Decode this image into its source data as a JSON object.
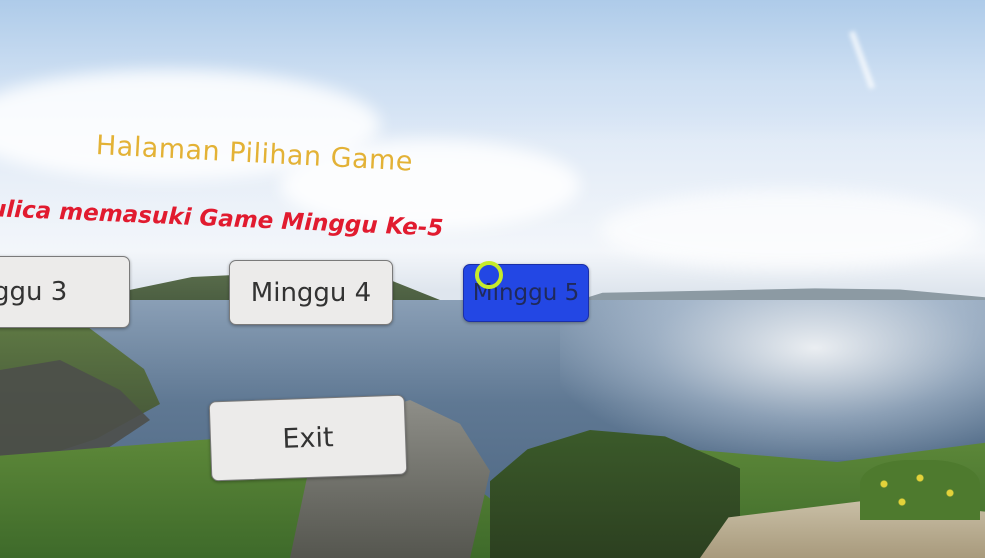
{
  "screen": {
    "title": "Halaman Pilihan Game",
    "subtitle": "ulica memasuki Game Minggu Ke-5"
  },
  "menu": {
    "week3_label": "ggu 3",
    "week4_label": "Minggu 4",
    "week5_label": "Minggu 5",
    "exit_label": "Exit"
  },
  "colors": {
    "title": "#e3b236",
    "subtitle": "#e11b2f",
    "selected_button": "#2347e4",
    "reticle": "#c6ec2a",
    "button_bg": "#ecebea"
  },
  "icons": {
    "gaze_reticle": "ring"
  }
}
